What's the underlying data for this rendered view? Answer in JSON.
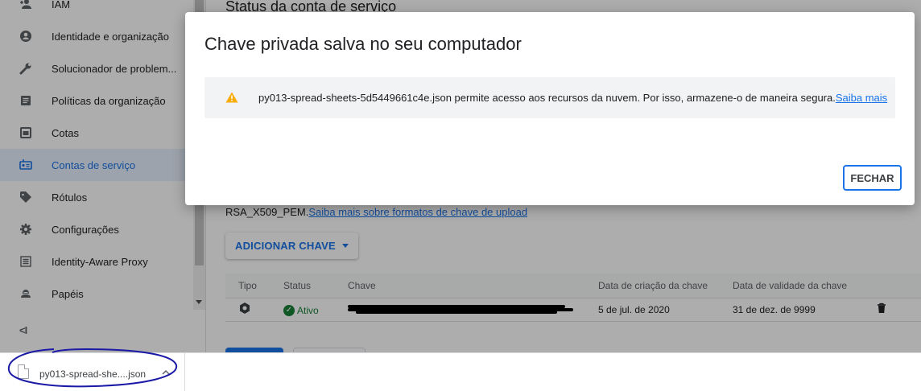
{
  "sidebar": {
    "items": [
      {
        "label": "IAM",
        "icon": "person-add-icon"
      },
      {
        "label": "Identidade e organização",
        "icon": "account-circle-icon"
      },
      {
        "label": "Solucionador de problem...",
        "icon": "wrench-icon"
      },
      {
        "label": "Políticas da organização",
        "icon": "list-document-icon"
      },
      {
        "label": "Cotas",
        "icon": "calendar-icon"
      },
      {
        "label": "Contas de serviço",
        "icon": "service-account-icon",
        "active": true
      },
      {
        "label": "Rótulos",
        "icon": "tag-icon"
      },
      {
        "label": "Configurações",
        "icon": "gear-icon"
      },
      {
        "label": "Identity-Aware Proxy",
        "icon": "proxy-icon"
      },
      {
        "label": "Papéis",
        "icon": "roles-icon"
      }
    ],
    "collapse_label": "<I"
  },
  "main": {
    "page_title": "Status da conta de serviço",
    "help_prefix": "RSA_X509_PEM.",
    "help_link": "Saiba mais sobre formatos de chave de upload",
    "add_key_label": "ADICIONAR CHAVE",
    "table": {
      "headers": [
        "Tipo",
        "Status",
        "Chave",
        "Data de criação da chave",
        "Data de validade da chave"
      ],
      "rows": [
        {
          "type_icon": "key-type-icon",
          "status": "Ativo",
          "key": "[redacted]",
          "created": "5 de jul. de 2020",
          "expires": "31 de dez. de 9999",
          "action_icon": "trash-icon"
        }
      ]
    }
  },
  "dialog": {
    "title": "Chave privada salva no seu computador",
    "warning_icon": "warning-icon",
    "note": "py013-spread-sheets-5d5449661c4e.json permite acesso aos recursos da nuvem. Por isso, armazene-o de maneira segura.",
    "note_link": "Saiba mais",
    "close_label": "FECHAR"
  },
  "download_bar": {
    "file_name": "py013-spread-she....json",
    "annotation_color": "#1a1aa6"
  },
  "colors": {
    "accent": "#1a73e8",
    "active_nav_bg": "#e8f0fe",
    "status_ok": "#188038",
    "warning": "#f9ab00"
  }
}
